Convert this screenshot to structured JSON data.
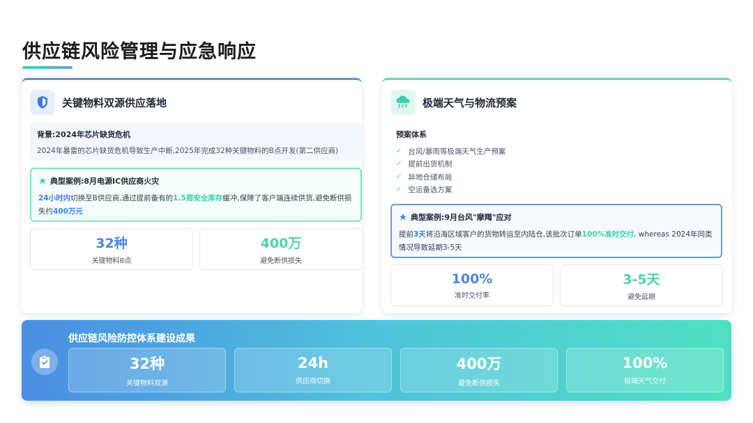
{
  "page": {
    "title": "供应链风险管理与应急响应"
  },
  "left_card": {
    "title": "关键物料双源供应落地",
    "icon": "shield-icon",
    "background": {
      "title": "背景:2024年芯片缺货危机",
      "text": "2024年暴雷的芯片缺货危机导致生产中断,2025年完成32种关键物料的B点开发(第二供应商)"
    },
    "case": {
      "title": "典型案例:8月电源IC供应商火灾",
      "hl1": "24小时内",
      "t1": "切换至B供应商,通过提前备有的",
      "hl2": "1.5周安全库存",
      "t2": "缓冲,保障了客户端连续供货,避免断供损失约",
      "hl3": "400万元"
    },
    "stats": [
      {
        "value": "32种",
        "label": "关键物料B点"
      },
      {
        "value": "400万",
        "label": "避免断供损失"
      }
    ]
  },
  "right_card": {
    "title": "极端天气与物流预案",
    "icon": "rain-cloud-icon",
    "plan": {
      "title": "预案体系",
      "items": [
        "台风/暴雨等极端天气生产预案",
        "提前出货机制",
        "异地仓储布局",
        "空运备选方案"
      ]
    },
    "case": {
      "title": "典型案例:9月台风\"摩羯\"应对",
      "t0": "提前",
      "hl1": "3天",
      "t1": "将沿海区域客户的货物转运至内陆仓,该批次订单",
      "hl2": "100%准时交付",
      "t2": ", whereas 2024年同类情况导致延期3-5天"
    },
    "stats": [
      {
        "value": "100%",
        "label": "准时交付率"
      },
      {
        "value": "3-5天",
        "label": "避免延期"
      }
    ]
  },
  "banner": {
    "title": "供应链风险防控体系建设成果",
    "icon": "clipboard-check-icon",
    "stats": [
      {
        "value": "32种",
        "label": "关键物料双源"
      },
      {
        "value": "24h",
        "label": "供应商切换"
      },
      {
        "value": "400万",
        "label": "避免断供损失"
      },
      {
        "value": "100%",
        "label": "极端天气交付"
      }
    ]
  },
  "colors": {
    "blue": "#4a86d9",
    "teal": "#4fd1a9"
  }
}
